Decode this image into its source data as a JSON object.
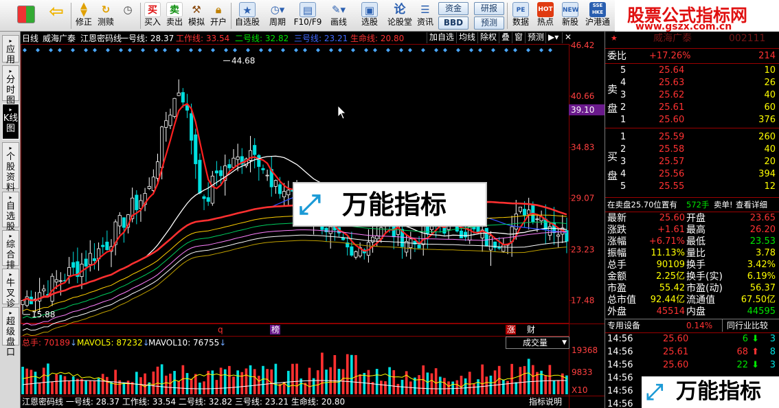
{
  "toolbar": {
    "buttons": [
      {
        "label": "",
        "icon": "grid"
      },
      {
        "label": "",
        "icon": "back"
      },
      {
        "label": "修正",
        "icon": "updown"
      },
      {
        "label": "测赎",
        "icon": "refresh"
      },
      {
        "label": "",
        "icon": "clock"
      },
      {
        "label": "买入",
        "icon": "买"
      },
      {
        "label": "卖出",
        "icon": "卖"
      },
      {
        "label": "模拟",
        "icon": "hammer"
      },
      {
        "label": "开户",
        "icon": "lock"
      },
      {
        "label": "自选股",
        "icon": "star"
      },
      {
        "label": "周期",
        "icon": "period"
      },
      {
        "label": "F10/F9",
        "icon": "f10"
      },
      {
        "label": "画线",
        "icon": "pen"
      },
      {
        "label": "选股",
        "icon": "select"
      },
      {
        "label": "论股堂",
        "icon": "论"
      },
      {
        "label": "资讯",
        "icon": "news"
      },
      {
        "label": "数据",
        "icon": "PE"
      },
      {
        "label": "热点",
        "icon": "HOT"
      },
      {
        "label": "新股",
        "icon": "NEW"
      },
      {
        "label": "沪港通",
        "icon": "SSE HKE"
      }
    ],
    "pills": [
      "资金",
      "研报",
      "BBD",
      "预测"
    ]
  },
  "banner": {
    "title": "股票公式指标网",
    "url": "www.gszx.com.cn"
  },
  "left_tabs": [
    {
      "label": "应用",
      "active": false
    },
    {
      "label": "分时图",
      "active": false
    },
    {
      "label": "K线图",
      "active": true
    },
    {
      "label": "个股资料",
      "active": false
    },
    {
      "label": "自选股",
      "active": false
    },
    {
      "label": "综合排名",
      "active": false
    },
    {
      "label": "牛叉诊股",
      "active": false
    },
    {
      "label": "超级盘口",
      "active": false
    }
  ],
  "chart": {
    "period": "日线",
    "stock": "威海广泰",
    "indicator": "江恩密码线",
    "lines": [
      {
        "label": "一号线: 28.37",
        "color": "#ffffff"
      },
      {
        "label": "工作线: 33.54",
        "color": "#ff3232"
      },
      {
        "label": "二号线: 32.82",
        "color": "#00e600"
      },
      {
        "label": "三号线: 23.21",
        "color": "#4169ff"
      },
      {
        "label": "生命线: 20.80",
        "color": "#ff3232"
      }
    ],
    "buttons": [
      "加自选",
      "均线",
      "除权",
      "叠",
      "窗",
      "预测"
    ],
    "y_labels": [
      "46.42",
      "40.66",
      "34.83",
      "29.07",
      "23.23",
      "17.48"
    ],
    "current_price_tag": "39.10",
    "high_label": "44.68",
    "low_label": "15.88",
    "event_marks": [
      "q",
      "榜",
      "涨",
      "财"
    ],
    "volume": {
      "total_label": "总手: 70189",
      "mavol5": "MAVOL5: 87232",
      "mavol10": "MAVOL10: 76755",
      "selector": "成交量",
      "y_labels": [
        "19368",
        "9833"
      ],
      "unit": "X10"
    },
    "footer_text": "江恩密码线 一号线: 28.37  工作线: 33.54  二号线: 32.82  三号线: 23.21  生命线: 20.80",
    "footer_right": "指标说明"
  },
  "overlay_logo": {
    "text": "万能指标"
  },
  "quote": {
    "header": {
      "stock": "威海广泰",
      "code": "002111"
    },
    "webi": {
      "label": "委比",
      "value": "+17.26%",
      "diff": "214"
    },
    "sell": [
      {
        "lvl": "5",
        "price": "25.64",
        "vol": "10"
      },
      {
        "lvl": "4",
        "price": "25.63",
        "vol": "26"
      },
      {
        "lvl": "3",
        "price": "25.62",
        "vol": "40"
      },
      {
        "lvl": "2",
        "price": "25.61",
        "vol": "60"
      },
      {
        "lvl": "1",
        "price": "25.60",
        "vol": "376"
      }
    ],
    "buy": [
      {
        "lvl": "1",
        "price": "25.59",
        "vol": "260"
      },
      {
        "lvl": "2",
        "price": "25.58",
        "vol": "40"
      },
      {
        "lvl": "3",
        "price": "25.57",
        "vol": "20"
      },
      {
        "lvl": "4",
        "price": "25.56",
        "vol": "394"
      },
      {
        "lvl": "5",
        "price": "25.55",
        "vol": "12"
      }
    ],
    "sell_label": [
      "卖",
      "盘"
    ],
    "buy_label": [
      "买",
      "盘"
    ],
    "info_line": {
      "left": "在卖盘25.70位置有",
      "mid": "572手",
      "right1": "卖单!",
      "right2": "查看详细"
    },
    "stats": [
      {
        "k1": "最新",
        "v1": "25.60",
        "k2": "开盘",
        "v2": "23.65"
      },
      {
        "k1": "涨跌",
        "v1": "+1.61",
        "k2": "最高",
        "v2": "26.20"
      },
      {
        "k1": "涨幅",
        "v1": "+6.71%",
        "k2": "最低",
        "v2": "23.53"
      },
      {
        "k1": "振幅",
        "v1": "11.13%",
        "k2": "量比",
        "v2": "3.78"
      },
      {
        "k1": "总手",
        "v1": "90109",
        "k2": "换手",
        "v2": "3.42%"
      },
      {
        "k1": "金额",
        "v1": "2.25亿",
        "k2": "换手(实)",
        "v2": "6.19%"
      },
      {
        "k1": "市盈",
        "v1": "55.42",
        "k2": "市盈(动)",
        "v2": "56.37"
      },
      {
        "k1": "总市值",
        "v1": "92.44亿",
        "k2": "流通值",
        "v2": "67.50亿"
      },
      {
        "k1": "外盘",
        "v1": "45514",
        "k2": "内盘",
        "v2": "44595"
      }
    ],
    "equipment": {
      "label": "专用设备",
      "pct": "0.14%",
      "compare": "同行业比较"
    },
    "ticks": [
      {
        "time": "14:56",
        "price": "25.60",
        "vol": "6",
        "dir": "down",
        "n": "3"
      },
      {
        "time": "14:56",
        "price": "25.61",
        "vol": "68",
        "dir": "up",
        "n": "8"
      },
      {
        "time": "14:56",
        "price": "25.60",
        "vol": "22",
        "dir": "down",
        "n": "3"
      },
      {
        "time": "14:56",
        "price": "",
        "vol": "",
        "dir": "",
        "n": ""
      },
      {
        "time": "14:56",
        "price": "",
        "vol": "",
        "dir": "",
        "n": ""
      },
      {
        "time": "14:56",
        "price": "",
        "vol": "",
        "dir": "",
        "n": ""
      }
    ]
  },
  "colors": {
    "up": "#ff3232",
    "down": "#00e600",
    "bg": "#000000",
    "panel_line": "#9b0000"
  }
}
